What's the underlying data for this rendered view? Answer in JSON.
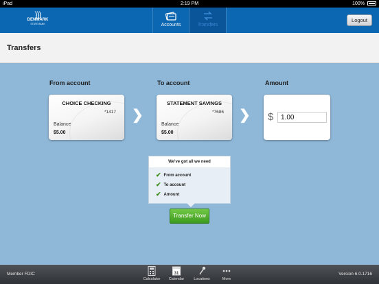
{
  "status": {
    "device": "iPad",
    "time": "2:19 PM",
    "battery": "100%"
  },
  "header": {
    "logo_name": "DENMARK",
    "logo_sub": "STATE BANK",
    "tabs": [
      {
        "label": "Accounts"
      },
      {
        "label": "Transfers"
      }
    ],
    "logout": "Logout"
  },
  "page": {
    "title": "Transfers"
  },
  "transfer": {
    "from_label": "From account",
    "to_label": "To account",
    "amount_label": "Amount",
    "from": {
      "name": "CHOICE CHECKING",
      "number": "*1417",
      "balance_label": "Balance",
      "balance": "$5.00"
    },
    "to": {
      "name": "STATEMENT SAVINGS",
      "number": "*7686",
      "balance_label": "Balance",
      "balance": "$5.00"
    },
    "currency": "$",
    "amount": "1.00"
  },
  "checklist": {
    "title": "We've got all we need",
    "items": [
      "From account",
      "To account",
      "Amount"
    ]
  },
  "actions": {
    "transfer_now": "Transfer Now"
  },
  "footer": {
    "left": "Member FDIC",
    "version": "Version 6.0.1716",
    "tabs": [
      "Calculator",
      "Calendar",
      "Locations",
      "More"
    ],
    "calendar_day": "31"
  }
}
